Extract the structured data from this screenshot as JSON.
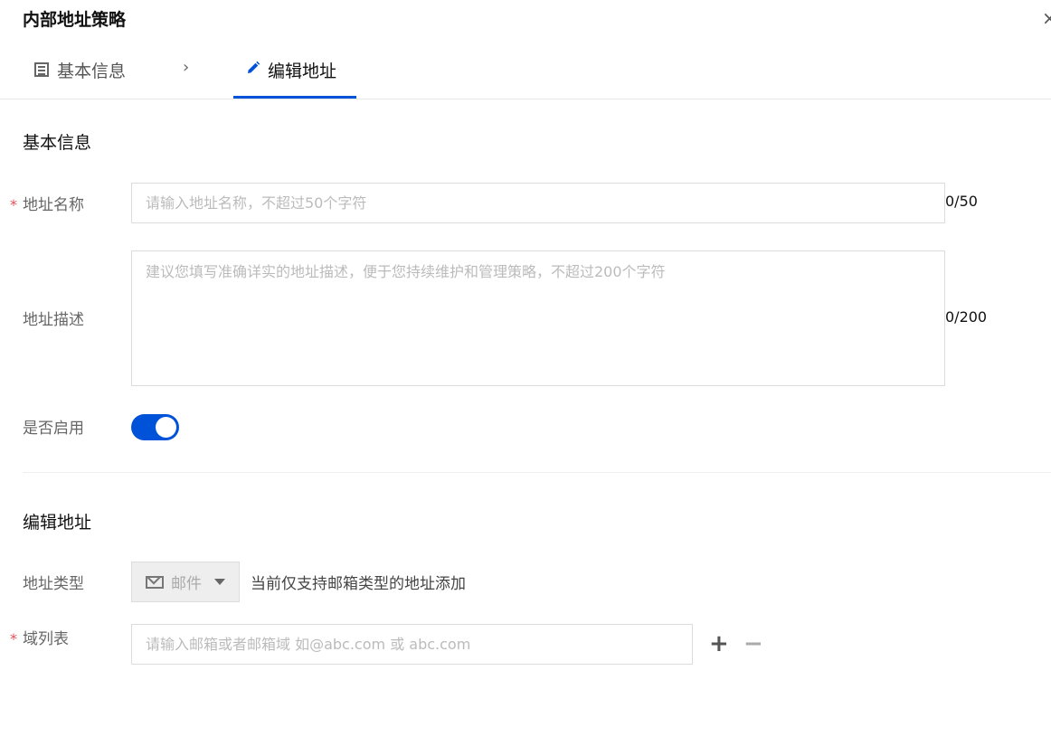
{
  "dialog": {
    "title": "内部地址策略",
    "close_icon": "×"
  },
  "tabs": [
    {
      "label": "基本信息",
      "icon": "list-icon"
    },
    {
      "label": "编辑地址",
      "icon": "pencil-icon"
    }
  ],
  "tab_separator": "›",
  "accent_color": "#0052d9",
  "basic": {
    "section_title": "基本信息",
    "name": {
      "label": "地址名称",
      "required_mark": "*",
      "placeholder": "请输入地址名称，不超过50个字符",
      "value": "",
      "count": "0/50"
    },
    "desc": {
      "label": "地址描述",
      "placeholder": "建议您填写准确详实的地址描述，便于您持续维护和管理策略，不超过200个字符",
      "value": "",
      "count": "0/200"
    },
    "enable": {
      "label": "是否启用",
      "on": true
    }
  },
  "edit": {
    "section_title": "编辑地址",
    "type": {
      "label": "地址类型",
      "selected": "邮件",
      "icon": "mail-icon",
      "hint": "当前仅支持邮箱类型的地址添加"
    },
    "domains": {
      "label": "域列表",
      "required_mark": "*",
      "placeholder": "请输入邮箱或者邮箱域 如@abc.com 或 abc.com",
      "value": "",
      "add": "+",
      "remove": "−"
    }
  }
}
